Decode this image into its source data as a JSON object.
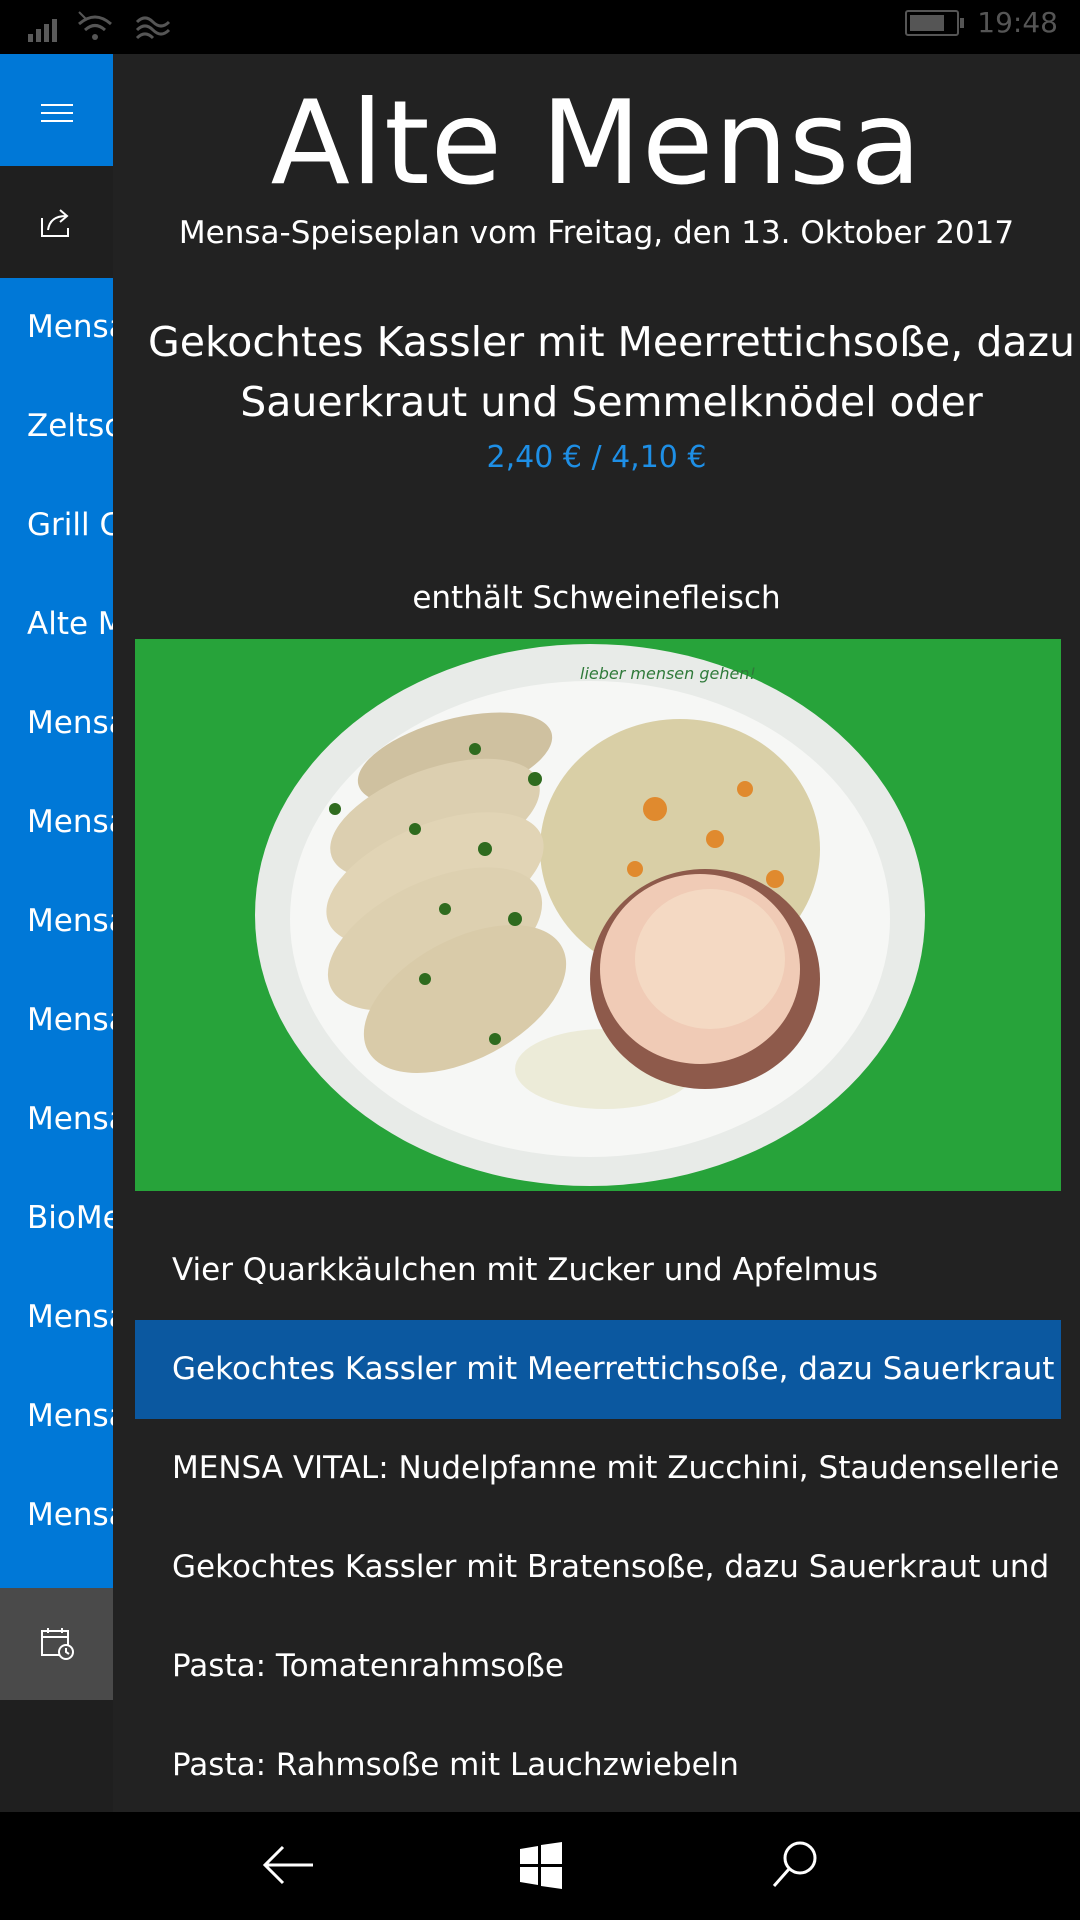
{
  "status_bar": {
    "time": "19:48",
    "icons": [
      "signal-icon",
      "wifi-icon",
      "data-icon",
      "battery-charging-icon"
    ]
  },
  "sidebar": {
    "menu_icon": "hamburger-icon",
    "share_icon": "share-icon",
    "calendar_icon": "calendar-icon",
    "items": [
      {
        "label": "Mensa"
      },
      {
        "label": "Zeltschlösschen"
      },
      {
        "label": "Grill Cube"
      },
      {
        "label": "Alte Mensa"
      },
      {
        "label": "Mensa"
      },
      {
        "label": "Mensa"
      },
      {
        "label": "Mensa"
      },
      {
        "label": "Mensa"
      },
      {
        "label": "Mensa"
      },
      {
        "label": "BioMensa"
      },
      {
        "label": "Mensa"
      },
      {
        "label": "Mensa"
      },
      {
        "label": "Mensa"
      }
    ]
  },
  "main": {
    "title": "Alte Mensa",
    "subtitle": "Mensa-Speiseplan vom Freitag, den 13. Oktober 2017",
    "dish": {
      "name": "Gekochtes Kassler mit Meerrettichsoße, dazu Sauerkraut und Semmelknödel oder",
      "price": "2,40 € / 4,10 €",
      "allergen": "enthält Schweinefleisch",
      "photo_text": "lieber mensen gehen!"
    },
    "menu_items": [
      {
        "label": "Vier Quarkkäulchen mit Zucker und Apfelmus",
        "selected": false
      },
      {
        "label": "Gekochtes Kassler mit Meerrettichsoße, dazu Sauerkraut und Semmelknödel oder",
        "selected": true
      },
      {
        "label": "MENSA VITAL: Nudelpfanne mit Zucchini, Staudensellerie,",
        "selected": false
      },
      {
        "label": "Gekochtes Kassler mit Bratensoße, dazu Sauerkraut und Semmelknödel",
        "selected": false
      },
      {
        "label": "Pasta: Tomatenrahmsoße",
        "selected": false
      },
      {
        "label": "Pasta: Rahmsoße mit Lauchzwiebeln",
        "selected": false
      }
    ]
  },
  "nav_bar": {
    "icons": [
      "back-icon",
      "windows-icon",
      "search-icon"
    ]
  },
  "colors": {
    "accent": "#0078d7",
    "selected": "#0b58a0",
    "price": "#1e8fe6",
    "photo_background": "#27a33a"
  }
}
